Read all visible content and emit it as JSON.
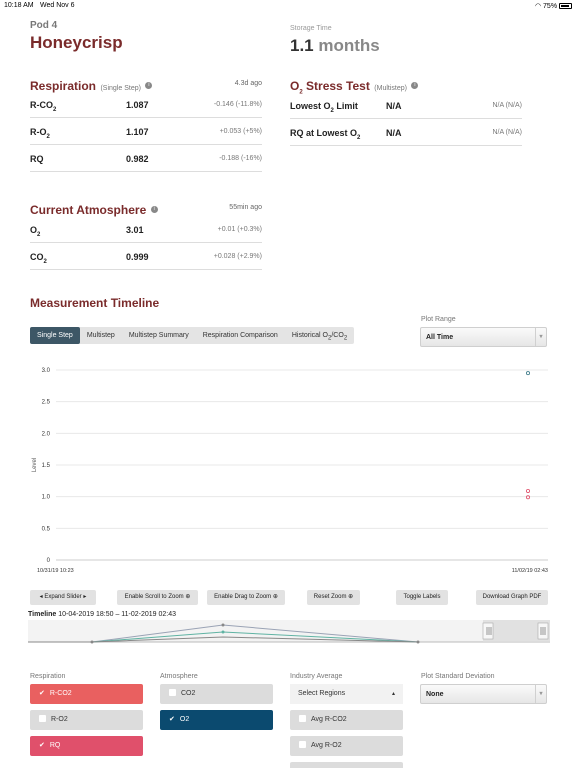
{
  "status_bar": {
    "time": "10:18 AM",
    "date": "Wed Nov 6",
    "battery": "75%"
  },
  "header": {
    "pod": "Pod 4",
    "variety": "Honeycrisp",
    "storage_label": "Storage Time",
    "storage_value": "1.1",
    "storage_unit": "months"
  },
  "respiration": {
    "title": "Respiration",
    "subtitle": "(Single Step)",
    "ago": "4.3d ago",
    "rows": [
      {
        "label": "R-CO",
        "sub": "2",
        "value": "1.087",
        "change": "-0.146 (-11.8%)"
      },
      {
        "label": "R-O",
        "sub": "2",
        "value": "1.107",
        "change": "+0.053 (+5%)"
      },
      {
        "label": "RQ",
        "sub": "",
        "value": "0.982",
        "change": "-0.188 (-16%)"
      }
    ]
  },
  "stress": {
    "title_pre": "O",
    "title_sub": "2",
    "title_post": " Stress Test",
    "subtitle": "(Multistep)",
    "rows": [
      {
        "label": "Lowest O",
        "sub": "2",
        "label_post": " Limit",
        "value": "N/A",
        "change": "N/A (N/A)"
      },
      {
        "label": "RQ at Lowest O",
        "sub": "2",
        "label_post": "",
        "value": "N/A",
        "change": "N/A (N/A)"
      }
    ]
  },
  "atmosphere": {
    "title": "Current Atmosphere",
    "ago": "55min ago",
    "rows": [
      {
        "label": "O",
        "sub": "2",
        "value": "3.01",
        "change": "+0.01 (+0.3%)"
      },
      {
        "label": "CO",
        "sub": "2",
        "value": "0.999",
        "change": "+0.028 (+2.9%)"
      }
    ]
  },
  "timeline": {
    "title": "Measurement Timeline",
    "tabs": [
      "Single Step",
      "Multistep",
      "Multistep Summary",
      "Respiration Comparison",
      "Historical O2/CO2"
    ],
    "plot_range_label": "Plot Range",
    "plot_range_value": "All Time",
    "buttons": [
      "Expand Slider",
      "Enable Scroll to Zoom",
      "Enable Drag to Zoom",
      "Reset Zoom",
      "Toggle Labels",
      "Download Graph PDF"
    ],
    "range_label": "Timeline",
    "range_text": "10-04-2019 18:50 – 11-02-2019 02:43"
  },
  "chart_data": {
    "type": "scatter",
    "ylabel": "Level",
    "ylim": [
      0,
      3.0
    ],
    "yticks": [
      "0",
      "0.5",
      "1.0",
      "1.5",
      "2.0",
      "2.5",
      "3.0"
    ],
    "x_start_label": "10/31/19 10:23",
    "x_end_label": "11/02/19 02:43",
    "series": [
      {
        "color": "#3d7a88",
        "points": [
          {
            "x": "11/02/19 02:43",
            "y": 2.95
          }
        ]
      },
      {
        "color": "#e0506b",
        "points": [
          {
            "x": "11/02/19 02:43",
            "y": 1.09
          },
          {
            "x": "11/02/19 02:43",
            "y": 0.99
          }
        ]
      }
    ]
  },
  "filters": {
    "respiration_label": "Respiration",
    "respiration": [
      {
        "label": "R-CO2",
        "checked": true,
        "color": "#e96060"
      },
      {
        "label": "R-O2",
        "checked": false,
        "color": "#dcdcdc"
      },
      {
        "label": "RQ",
        "checked": true,
        "color": "#e0506b"
      }
    ],
    "atmosphere_label": "Atmosphere",
    "atmosphere": [
      {
        "label": "CO2",
        "checked": false,
        "color": "#dcdcdc"
      },
      {
        "label": "O2",
        "checked": true,
        "color": "#0b4a6f"
      }
    ],
    "industry_label": "Industry Average",
    "industry_select": "Select Regions",
    "industry": [
      {
        "label": "Avg R-CO2",
        "checked": false
      },
      {
        "label": "Avg R-O2",
        "checked": false
      }
    ],
    "std_label": "Plot Standard Deviation",
    "std_value": "None"
  }
}
